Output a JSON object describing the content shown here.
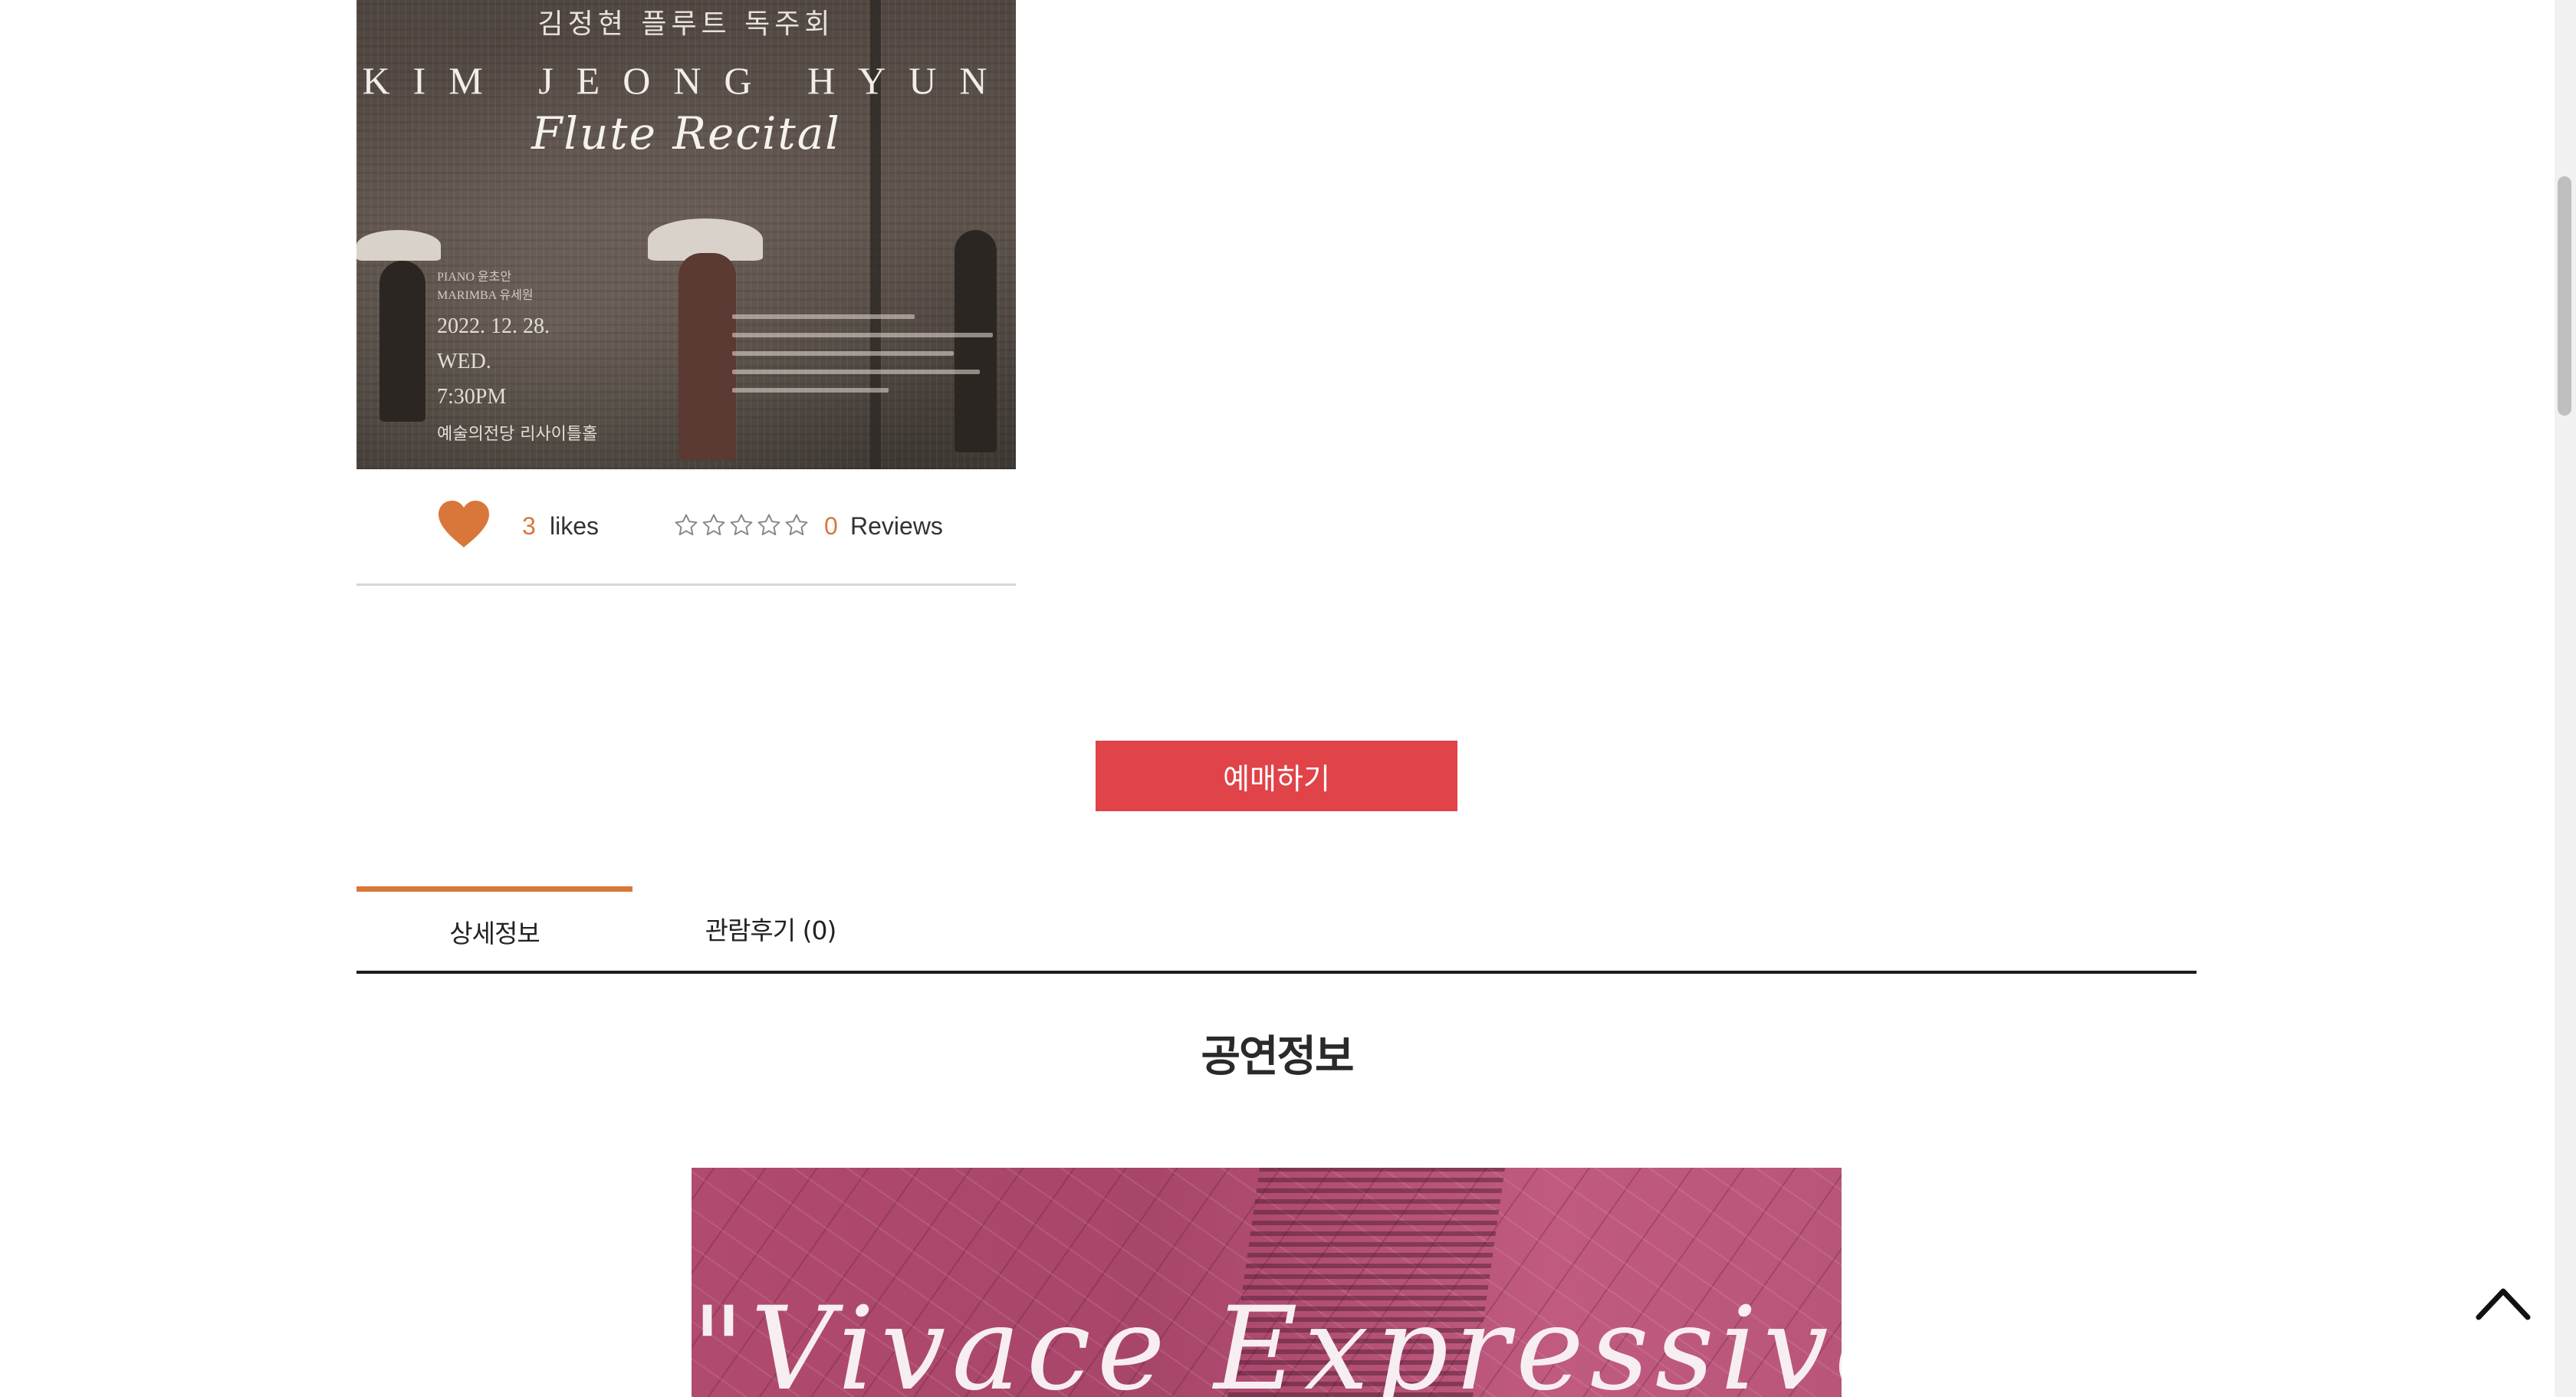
{
  "poster": {
    "korean_title": "김정현 플루트 독주회",
    "english_title": "KIM JEONG HYUN",
    "script_title": "Flute Recital",
    "piano": "PIANO 윤초안",
    "marimba": "MARIMBA 유세원",
    "date": "2022. 12. 28.",
    "weekday": "WED.",
    "time": "7:30PM",
    "venue": "예술의전당 리사이틀홀"
  },
  "stats": {
    "likes_count": "3",
    "likes_label": "likes",
    "reviews_count": "0",
    "reviews_label": "Reviews",
    "rating": 0,
    "rating_max": 5
  },
  "reserve_button_label": "예매하기",
  "tabs": [
    {
      "label": "상세정보",
      "active": true
    },
    {
      "label": "관람후기 (0)",
      "active": false
    }
  ],
  "section_title": "공연정보",
  "detail_image": {
    "script_text": "\"Vivace Expressivo\""
  },
  "icons": {
    "heart": "heart-icon",
    "star": "star-outline-icon",
    "back_to_top": "chevron-up-icon"
  },
  "colors": {
    "accent": "#d9773a",
    "button": "#e04348",
    "tab_underline": "#1d1d1d"
  }
}
